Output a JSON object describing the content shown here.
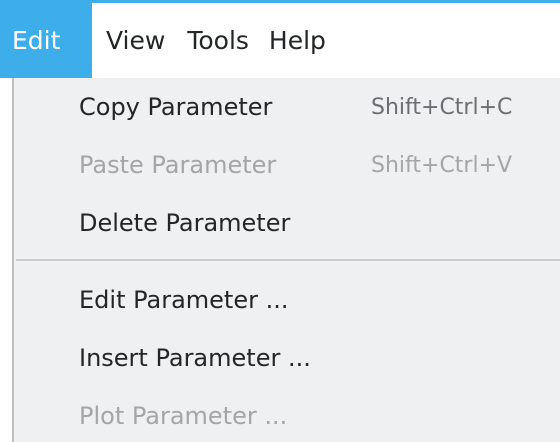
{
  "menubar": {
    "items": [
      {
        "label": "Edit",
        "active": true
      },
      {
        "label": "View"
      },
      {
        "label": "Tools"
      },
      {
        "label": "Help"
      }
    ]
  },
  "colors": {
    "accent": "#3daee9",
    "menu_bg": "#eff0f1",
    "text": "#232627",
    "disabled_text": "#a3a5a7"
  },
  "edit_menu": {
    "items": [
      {
        "label": "Copy Parameter",
        "shortcut": "Shift+Ctrl+C",
        "enabled": true
      },
      {
        "label": "Paste Parameter",
        "shortcut": "Shift+Ctrl+V",
        "enabled": false
      },
      {
        "label": "Delete Parameter",
        "shortcut": "",
        "enabled": true
      },
      {
        "label": "Edit Parameter ...",
        "shortcut": "",
        "enabled": true
      },
      {
        "label": "Insert Parameter ...",
        "shortcut": "",
        "enabled": true
      },
      {
        "label": "Plot Parameter ...",
        "shortcut": "",
        "enabled": false
      }
    ]
  }
}
